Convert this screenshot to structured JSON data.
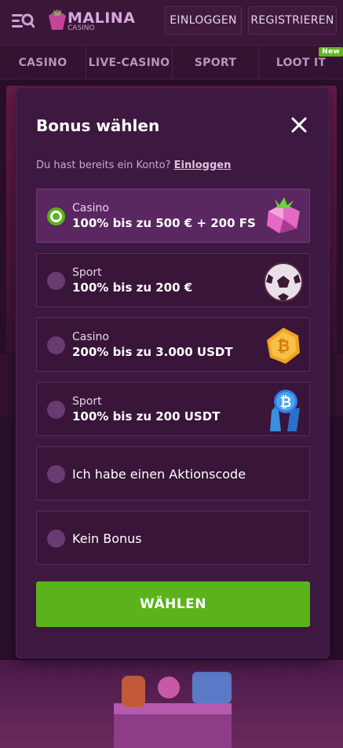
{
  "header": {
    "logo_text": "MALINA",
    "logo_sub": "CASINO",
    "login_label": "EINLOGGEN",
    "register_label": "REGISTRIEREN"
  },
  "nav": {
    "tabs": [
      {
        "label": "CASINO"
      },
      {
        "label": "LIVE-CASINO"
      },
      {
        "label": "SPORT"
      },
      {
        "label": "LOOT IT",
        "badge": "New"
      }
    ]
  },
  "modal": {
    "title": "Bonus wählen",
    "subtitle_text": "Du hast bereits ein Konto?",
    "subtitle_link": "Einloggen",
    "options": [
      {
        "category": "Casino",
        "title": "100% bis zu 500 € + 200 FS",
        "icon": "pink-gem-icon",
        "selected": true
      },
      {
        "category": "Sport",
        "title": "100% bis zu 200 €",
        "icon": "soccer-ball-icon",
        "selected": false
      },
      {
        "category": "Casino",
        "title": "200% bis zu 3.000 USDT",
        "icon": "bitcoin-coin-icon",
        "selected": false
      },
      {
        "category": "Sport",
        "title": "100% bis zu 200 USDT",
        "icon": "bitcoin-crystal-icon",
        "selected": false
      },
      {
        "label": "Ich habe einen Aktionscode",
        "selected": false
      },
      {
        "label": "Kein Bonus",
        "selected": false
      }
    ],
    "choose_label": "WÄHLEN"
  },
  "colors": {
    "accent_green": "#5bb31b",
    "modal_bg": "#3d1840",
    "page_bg": "#2a0f2c"
  }
}
